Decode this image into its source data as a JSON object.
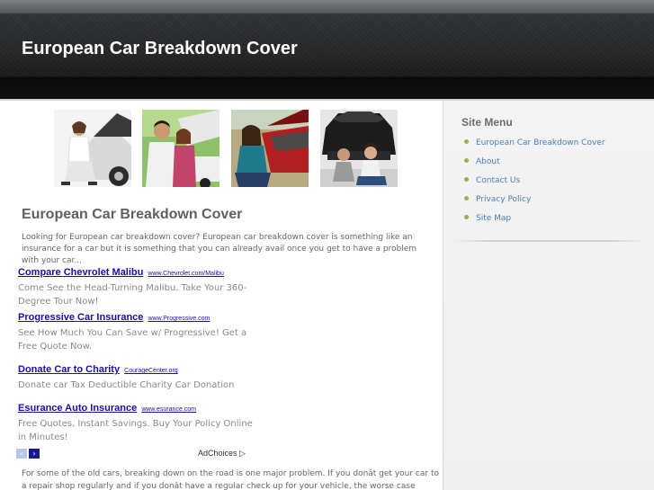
{
  "header": {
    "site_title": "European Car Breakdown Cover"
  },
  "post": {
    "title": "European Car Breakdown Cover",
    "intro": "Looking for European car breakdown cover? European car breakdown cover is something like an insurance for a car but it is something that you can already avail once you get to have a problem with your car...",
    "body": "For some of the old cars, breaking down on the road is one major problem. If you donât get your car to a repair shop regularly and if you donât have a regular check up for your vehicle, the worse case would be that your car"
  },
  "ads": [
    {
      "title": "Compare Chevrolet Malibu",
      "url": "www.Chevrolet.com/Malibu",
      "desc": "Come See the Head-Turning Malibu. Take Your 360-Degree Tour Now!"
    },
    {
      "title": "Progressive Car Insurance",
      "url": "www.Progressive.com",
      "desc": "See How Much You Can Save w/ Progressive! Get a Free Quote Now."
    },
    {
      "title": "Donate Car to Charity",
      "url": "CourageCenter.org",
      "desc": "Donate car Tax Deductible Charity Car Donation"
    },
    {
      "title": "Esurance Auto Insurance",
      "url": "www.esurance.com",
      "desc": "Free Quotes, Instant Savings. Buy Your Policy Online in Minutes!"
    }
  ],
  "ad_nav": {
    "prev_icon": "chevron-left-icon",
    "next_icon": "chevron-right-icon",
    "prev": "‹",
    "next": "›"
  },
  "adchoices": {
    "label": "AdChoices",
    "icon": "▷"
  },
  "sidebar": {
    "heading": "Site Menu",
    "items": [
      {
        "label": "European Car Breakdown Cover"
      },
      {
        "label": "About"
      },
      {
        "label": "Contact Us"
      },
      {
        "label": "Privacy Policy"
      },
      {
        "label": "Site Map"
      }
    ]
  },
  "colors": {
    "accent_link": "#4a7fb5",
    "ad_link": "#1a0dab",
    "bullet": "#8ab84a",
    "header_bg": "#242526"
  }
}
